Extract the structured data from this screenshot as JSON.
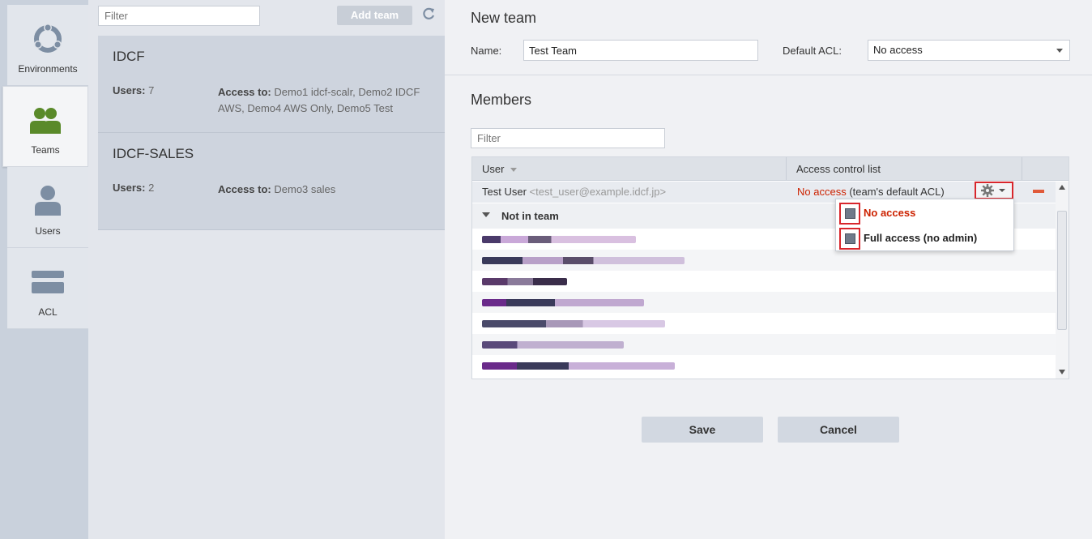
{
  "nav": {
    "items": [
      {
        "label": "Environments",
        "icon": "environments-icon",
        "active": false
      },
      {
        "label": "Teams",
        "icon": "teams-icon",
        "active": true
      },
      {
        "label": "Users",
        "icon": "user-icon",
        "active": false
      },
      {
        "label": "ACL",
        "icon": "acl-icon",
        "active": false
      }
    ]
  },
  "teams_panel": {
    "filter_placeholder": "Filter",
    "add_team_label": "Add team",
    "teams": [
      {
        "name": "IDCF",
        "users_label": "Users:",
        "users_count": "7",
        "access_label": "Access to:",
        "access_value": "Demo1 idcf-scalr, Demo2 IDCF AWS, Demo4 AWS Only, Demo5 Test"
      },
      {
        "name": "IDCF-SALES",
        "users_label": "Users:",
        "users_count": "2",
        "access_label": "Access to:",
        "access_value": "Demo3 sales"
      }
    ]
  },
  "form": {
    "title": "New team",
    "name_label": "Name:",
    "name_value": "Test Team",
    "default_acl_label": "Default ACL:",
    "default_acl_value": "No access",
    "members_title": "Members",
    "members_filter_placeholder": "Filter",
    "grid": {
      "col_user": "User",
      "col_acl": "Access control list",
      "member": {
        "name": "Test User",
        "email": "<test_user@example.idcf.jp>",
        "acl": "No access",
        "acl_note": "(team's default ACL)"
      },
      "group_label": "Not in team"
    },
    "acl_menu": [
      {
        "label": "No access",
        "color": "#cc2200"
      },
      {
        "label": "Full access (no admin)",
        "color": "#222222"
      }
    ],
    "save_label": "Save",
    "cancel_label": "Cancel"
  },
  "colors": {
    "accent_red": "#d8262c",
    "teams_green": "#5a8a2a"
  }
}
